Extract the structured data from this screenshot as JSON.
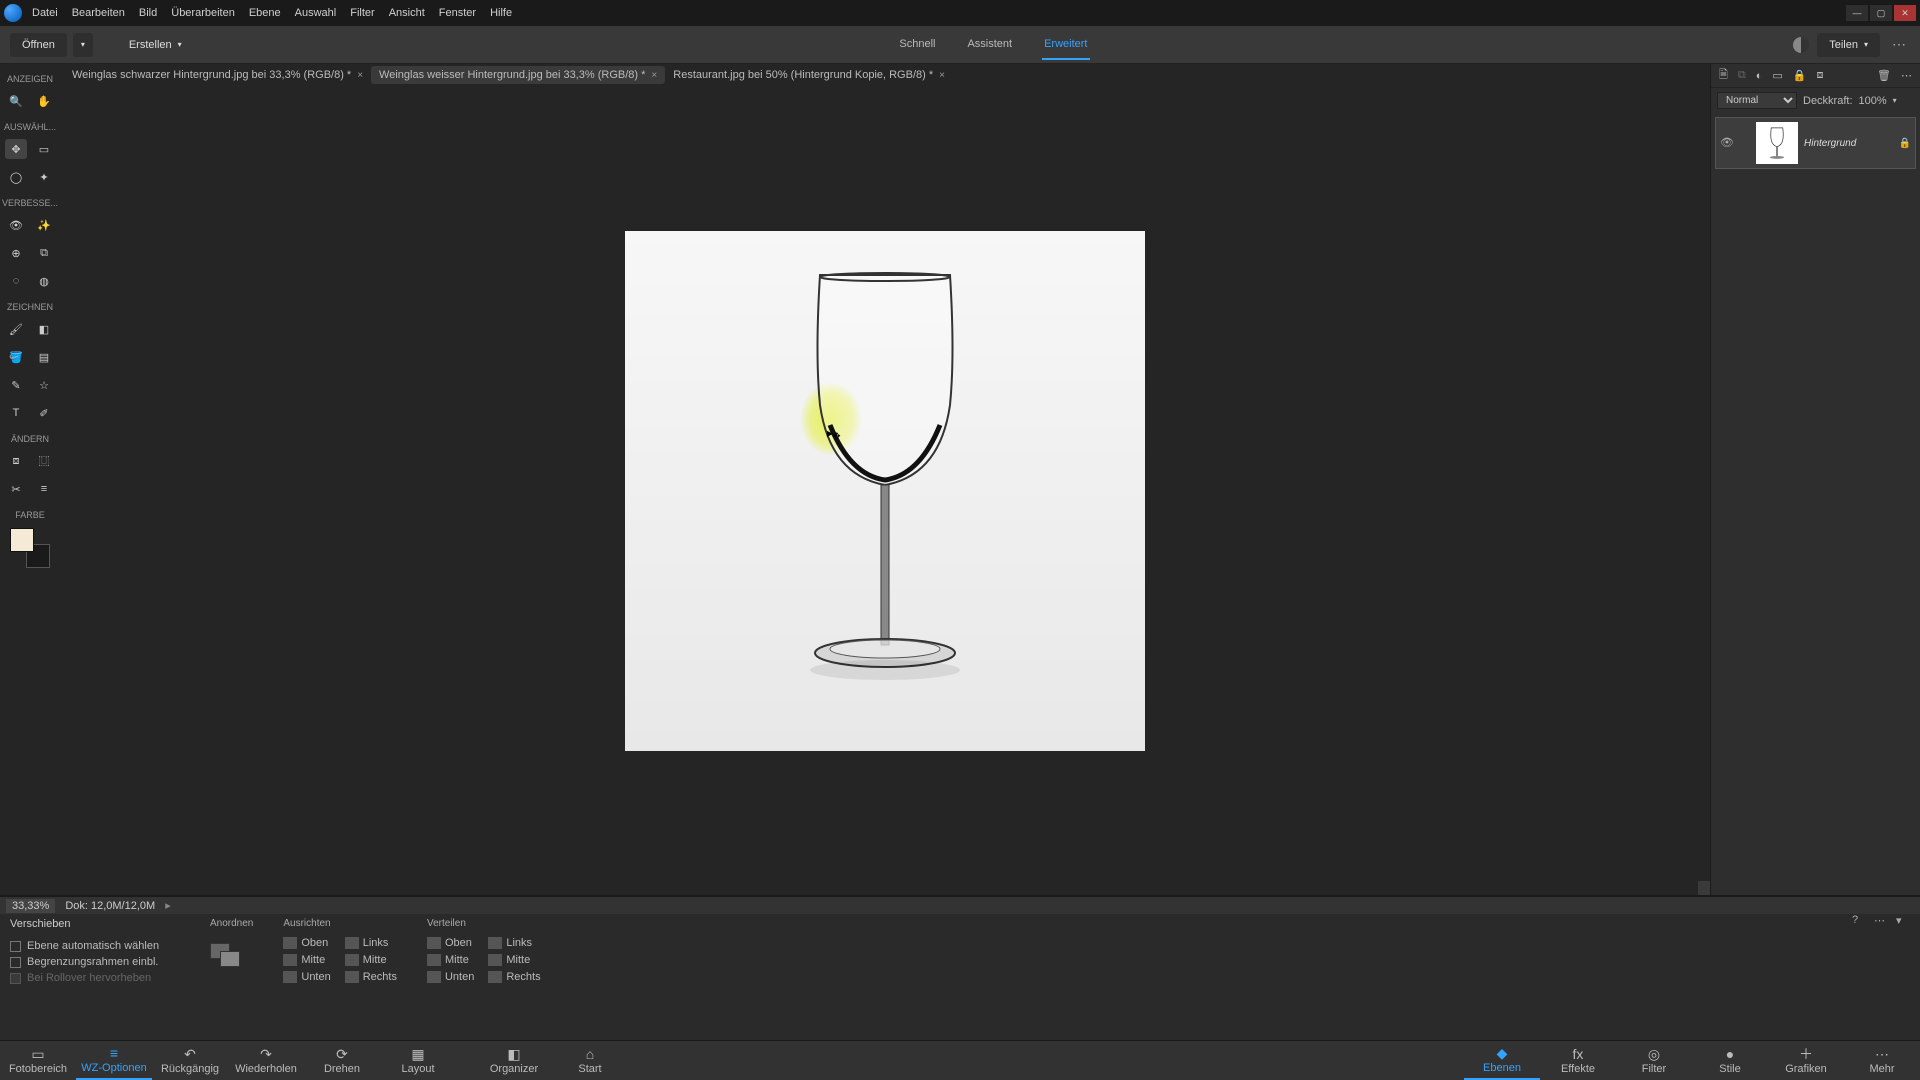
{
  "menu": [
    "Datei",
    "Bearbeiten",
    "Bild",
    "Überarbeiten",
    "Ebene",
    "Auswahl",
    "Filter",
    "Ansicht",
    "Fenster",
    "Hilfe"
  ],
  "actionbar": {
    "open": "Öffnen",
    "create": "Erstellen",
    "share": "Teilen",
    "modes": {
      "quick": "Schnell",
      "guided": "Assistent",
      "expert": "Erweitert"
    }
  },
  "documentTabs": [
    {
      "label": "Weinglas schwarzer Hintergrund.jpg bei 33,3% (RGB/8) *"
    },
    {
      "label": "Weinglas weisser Hintergrund.jpg bei 33,3% (RGB/8) *"
    },
    {
      "label": "Restaurant.jpg bei 50% (Hintergrund Kopie, RGB/8) *"
    }
  ],
  "activeTab": 1,
  "tool_groups": {
    "anzeigen": "ANZEIGEN",
    "auswahl": "AUSWÄHL...",
    "verbessern": "VERBESSE...",
    "zeichnen": "ZEICHNEN",
    "aendern": "ÄNDERN",
    "farbe": "FARBE"
  },
  "status": {
    "zoom": "33,33%",
    "doc": "Dok: 12,0M/12,0M"
  },
  "layers_panel": {
    "blend_mode": "Normal",
    "opacity_label": "Deckkraft:",
    "opacity_value": "100%",
    "layer_name": "Hintergrund"
  },
  "options": {
    "tool_name": "Verschieben",
    "check1": "Ebene automatisch wählen",
    "check2": "Begrenzungsrahmen einbl.",
    "check3": "Bei Rollover hervorheben",
    "arrange": "Anordnen",
    "align": "Ausrichten",
    "distribute": "Verteilen",
    "labels": {
      "oben": "Oben",
      "mitte": "Mitte",
      "unten": "Unten",
      "links": "Links",
      "rechts": "Rechts"
    }
  },
  "bottombar": {
    "left": [
      {
        "k": "fotobereich",
        "label": "Fotobereich",
        "icon": "▭"
      },
      {
        "k": "wz",
        "label": "WZ-Optionen",
        "icon": "≡"
      },
      {
        "k": "undo",
        "label": "Rückgängig",
        "icon": "↶"
      },
      {
        "k": "redo",
        "label": "Wiederholen",
        "icon": "↷"
      },
      {
        "k": "rotate",
        "label": "Drehen",
        "icon": "⟳"
      },
      {
        "k": "layout",
        "label": "Layout",
        "icon": "▦"
      },
      {
        "k": "organizer",
        "label": "Organizer",
        "icon": "◧"
      },
      {
        "k": "start",
        "label": "Start",
        "icon": "⌂"
      }
    ],
    "right": [
      {
        "k": "ebenen",
        "label": "Ebenen",
        "icon": "◆"
      },
      {
        "k": "effekte",
        "label": "Effekte",
        "icon": "fx"
      },
      {
        "k": "filter",
        "label": "Filter",
        "icon": "◎"
      },
      {
        "k": "stile",
        "label": "Stile",
        "icon": "●"
      },
      {
        "k": "grafiken",
        "label": "Grafiken",
        "icon": "＋"
      },
      {
        "k": "mehr",
        "label": "Mehr",
        "icon": "⋯"
      }
    ]
  }
}
